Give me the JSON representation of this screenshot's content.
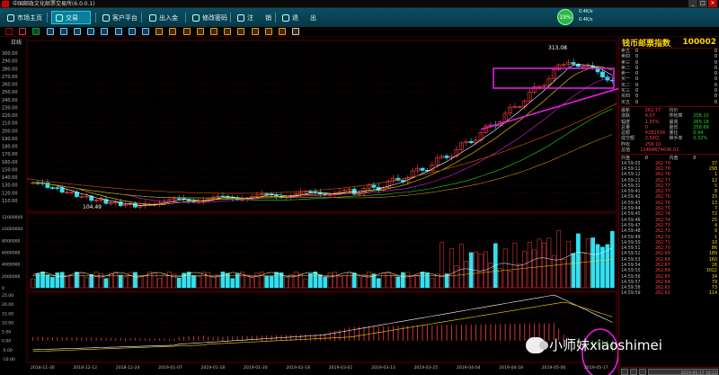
{
  "window": {
    "title": "中国邮政文化邮票交易所(6.0.0.1)",
    "controls": [
      "_",
      "□",
      "×"
    ]
  },
  "nav": {
    "items": [
      {
        "label": "市场主页",
        "icon": "home-icon"
      },
      {
        "label": "交易",
        "icon": "trade-icon"
      },
      {
        "label": "客户平台",
        "icon": "platform-icon"
      },
      {
        "label": "出入金",
        "icon": "transfer-icon"
      },
      {
        "label": "修改密码",
        "icon": "key-icon"
      },
      {
        "label": "注",
        "icon": "user-icon"
      },
      {
        "label": "销",
        "icon": ""
      },
      {
        "label": "退",
        "icon": "exit-icon"
      },
      {
        "label": "出",
        "icon": ""
      }
    ]
  },
  "account": {
    "percent": "19%",
    "rate_up": "0.4K/s",
    "rate_down": "0.4K/s"
  },
  "chart": {
    "period_label": "日线",
    "price_axis": [
      "300.00",
      "290.00",
      "280.00",
      "270.00",
      "260.00",
      "250.00",
      "240.00",
      "230.00",
      "220.00",
      "210.00",
      "200.00",
      "190.00",
      "180.00",
      "170.00",
      "160.00",
      "150.00",
      "140.00",
      "130.00",
      "120.00",
      "110.00"
    ],
    "high_label": "313.08",
    "low_label": "104.49",
    "volume_axis": [
      "12000000",
      "10000000",
      "8000000",
      "6000000",
      "4000000",
      "2000000",
      "0"
    ],
    "macd_axis": [
      "25.00",
      "20.00",
      "15.00",
      "10.00",
      "5.00",
      "0.00",
      "-5.00",
      "-10.00"
    ],
    "dates": [
      "2018-11-30",
      "2018-12-12",
      "2018-12-24",
      "2019-01-07",
      "2019-01-18",
      "2019-01-30",
      "2019-02-18",
      "2019-03-01",
      "2019-03-13",
      "2019-03-25",
      "2019-04-04",
      "2019-04-18",
      "2019-05-06",
      "2019-05-17"
    ]
  },
  "panel": {
    "name": "钱币邮票指数",
    "code": "100002",
    "orders": [
      {
        "label": "卖五",
        "price": "0",
        "vol": "0"
      },
      {
        "label": "卖四",
        "price": "0",
        "vol": "0"
      },
      {
        "label": "卖三",
        "price": "0",
        "vol": "0"
      },
      {
        "label": "卖二",
        "price": "0",
        "vol": "0"
      },
      {
        "label": "卖一",
        "price": "0",
        "vol": "0"
      },
      {
        "label": "买一",
        "price": "0",
        "vol": "0"
      },
      {
        "label": "买二",
        "price": "0",
        "vol": "0"
      },
      {
        "label": "买三",
        "price": "0",
        "vol": "0"
      },
      {
        "label": "买四",
        "price": "0",
        "vol": "0"
      },
      {
        "label": "买五",
        "price": "0",
        "vol": "0"
      }
    ],
    "stats": [
      {
        "k1": "最新",
        "v1": "262.77",
        "k2": "均价",
        "v2": ""
      },
      {
        "k1": "涨跌",
        "v1": "4.07",
        "k2": "昨结算",
        "v2": "258.10"
      },
      {
        "k1": "幅度",
        "v1": "1.55%",
        "k2": "最高",
        "v2": "265.18"
      },
      {
        "k1": "总量",
        "v1": "0",
        "k2": "最低",
        "v2": "258.68"
      },
      {
        "k1": "总额",
        "v1": "4282334",
        "k2": "量比",
        "v2": "0.94"
      },
      {
        "k1": "成交额",
        "v1": "2.56亿",
        "k2": "换手率",
        "v2": "0.32%"
      },
      {
        "k1": "昨收",
        "v1": "258.10",
        "k2": "",
        "v2": ""
      },
      {
        "k1": "总值",
        "v1": "11468674036.02",
        "k2": "",
        "v2": ""
      }
    ],
    "tick_header": {
      "a": "外盘",
      "b": "0",
      "c": "内盘",
      "d": "0"
    },
    "ticks": [
      {
        "t": "14:59:03",
        "p": "262.79",
        "v": "37"
      },
      {
        "t": "14:59:11",
        "p": "262.78",
        "v": "298"
      },
      {
        "t": "14:59:12",
        "p": "262.78",
        "v": "1"
      },
      {
        "t": "14:59:21",
        "p": "262.77",
        "v": "12"
      },
      {
        "t": "14:59:31",
        "p": "262.77",
        "v": "5"
      },
      {
        "t": "14:59:41",
        "p": "262.77",
        "v": "8"
      },
      {
        "t": "14:59:42",
        "p": "262.76",
        "v": "15"
      },
      {
        "t": "14:59:43",
        "p": "262.76",
        "v": "13"
      },
      {
        "t": "14:59:44",
        "p": "262.75",
        "v": "7"
      },
      {
        "t": "14:59:45",
        "p": "262.74",
        "v": "72"
      },
      {
        "t": "14:59:46",
        "p": "262.74",
        "v": "25"
      },
      {
        "t": "14:59:47",
        "p": "262.73",
        "v": "4"
      },
      {
        "t": "14:59:48",
        "p": "262.73",
        "v": "9"
      },
      {
        "t": "14:59:49",
        "p": "262.72",
        "v": "1"
      },
      {
        "t": "14:59:50",
        "p": "262.71",
        "v": "10"
      },
      {
        "t": "14:59:51",
        "p": "262.70",
        "v": "86"
      },
      {
        "t": "14:59:52",
        "p": "262.69",
        "v": "189"
      },
      {
        "t": "14:59:53",
        "p": "262.68",
        "v": "160"
      },
      {
        "t": "14:59:54",
        "p": "262.67",
        "v": "26"
      },
      {
        "t": "14:59:55",
        "p": "262.66",
        "v": "3022"
      },
      {
        "t": "14:59:56",
        "p": "262.65",
        "v": "34"
      },
      {
        "t": "14:59:57",
        "p": "262.64",
        "v": "79"
      },
      {
        "t": "14:59:58",
        "p": "262.63",
        "v": "73"
      },
      {
        "t": "14:59:59",
        "p": "262.62",
        "v": "114"
      }
    ],
    "footer_date": "2019-05-17 16:21"
  },
  "watermark": {
    "text": "小师妹xiaoshimei"
  },
  "colors": {
    "up": "#ff4040",
    "down": "#33e0f0",
    "nav_bg": "#0b4f63",
    "annotation": "#e020e0"
  }
}
